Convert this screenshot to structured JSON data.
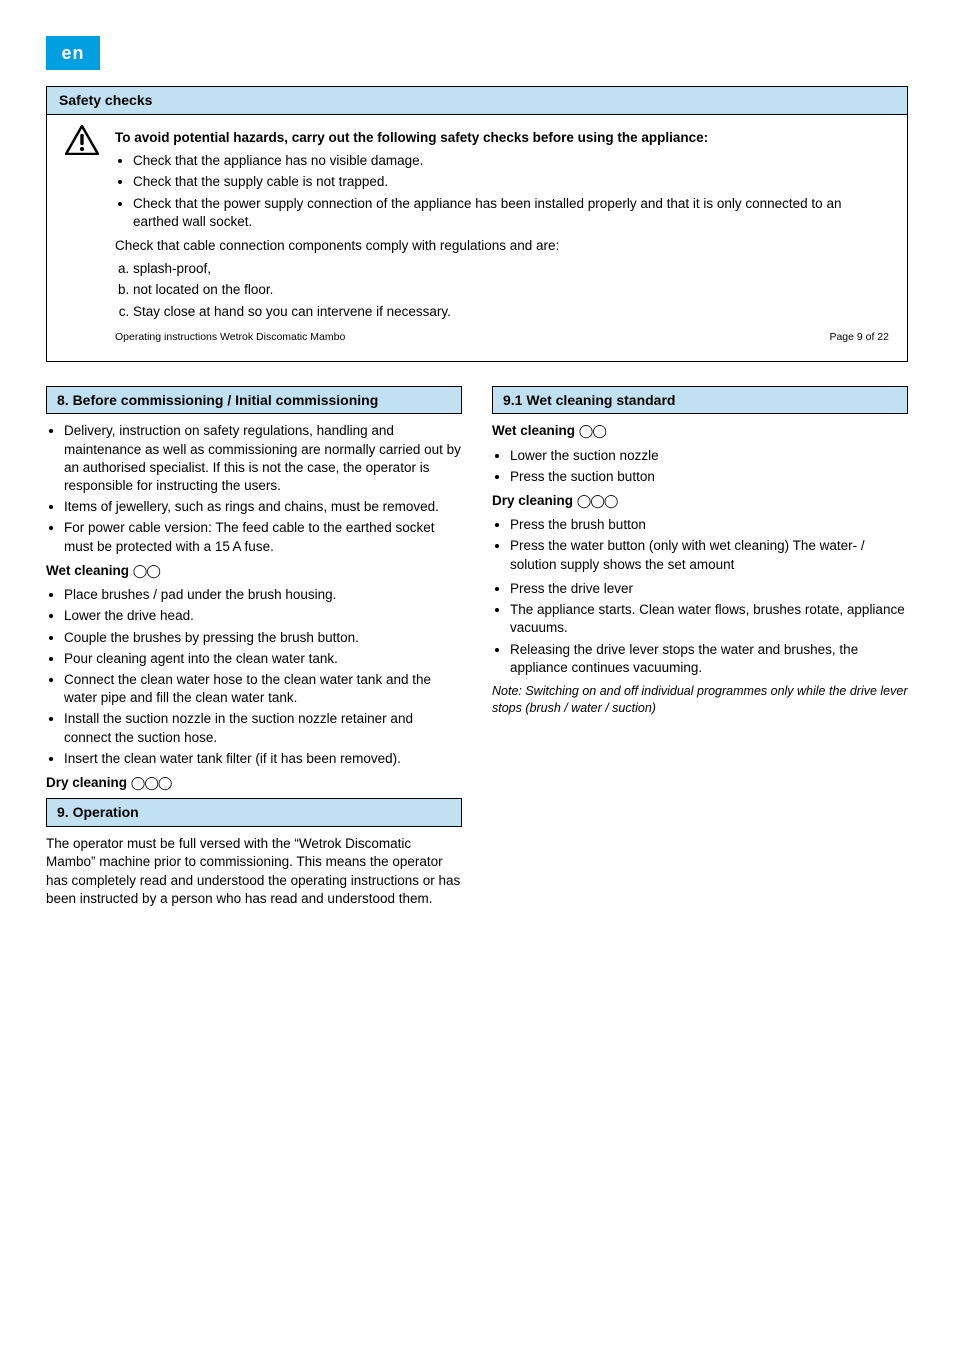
{
  "lang_tag": "en",
  "safety": {
    "title": "Safety checks",
    "lead": "To avoid potential hazards, carry out the following safety checks before using the appliance:",
    "items": [
      "Check that the appliance has no visible damage.",
      "Check that the supply cable is not trapped.",
      "Check that the power supply connection of the appliance has been installed properly and that it is only connected to an earthed wall socket."
    ],
    "sub_intro": "Check that cable connection components comply with regulations and are:",
    "sub_items": [
      "splash-proof,",
      "not located on the floor.",
      "Stay close at hand so you can intervene if necessary."
    ],
    "caption_left": "Operating instructions Wetrok Discomatic Mambo",
    "caption_right": "Page 9 of 22"
  },
  "col_left": {
    "sec8_title": "8. Before commissioning / Initial commissioning",
    "sec8_items": [
      "Delivery, instruction on safety regulations, handling and maintenance as well as commissioning are normally carried out by an authorised specialist. If this is not the case, the operator is responsible for instructing the users.",
      "Items of jewellery, such as rings and chains, must be removed.",
      "For power cable version: The feed cable to the earthed socket must be protected with a 15 A fuse."
    ],
    "sec8_wet_label": "Wet cleaning ",
    "sec8_wet_circles": "◯◯",
    "sec8_wet_items": [
      "Place brushes / pad under the brush housing.",
      "Lower the drive head.",
      "Couple the brushes by pressing the brush button.",
      "Pour cleaning agent into the clean water tank.",
      "Connect the clean water hose to the clean water tank and the water pipe and fill the clean water tank.",
      "Install the suction nozzle in the suction nozzle retainer and connect the suction hose.",
      "Insert the clean water tank filter (if it has been removed)."
    ],
    "sec8_dry_label": "Dry cleaning ",
    "sec8_dry_circles": "◯◯◯",
    "sec9_title": "9. Operation",
    "sec9_body": "The operator must be full versed with the “Wetrok Discomatic Mambo” machine prior to commissioning. This means the operator has completely read and understood the operating instructions or has been instructed by a person who has read and understood them."
  },
  "col_right": {
    "sec91_title": "9.1 Wet cleaning standard",
    "sec91_wet_label": "Wet cleaning ",
    "sec91_wet_circles": "◯◯",
    "sec91_wet_items": [
      "Lower the suction nozzle",
      "Press the suction button"
    ],
    "sec91_dry_label": "Dry cleaning ",
    "sec91_dry_circles": "◯◯◯",
    "sec91_dry_items": [
      "Press the brush button",
      "Press the water button (only with wet cleaning) The water- / solution supply shows the set amount"
    ],
    "sec91_after_items": [
      "Press the drive lever",
      "The appliance starts. Clean water flows, brushes rotate, appliance vacuums.",
      "Releasing the drive lever stops the water and brushes, the appliance continues vacuuming."
    ],
    "sec91_note": "Note: Switching on and off individual programmes only while the drive lever stops (brush / water / suction)"
  }
}
